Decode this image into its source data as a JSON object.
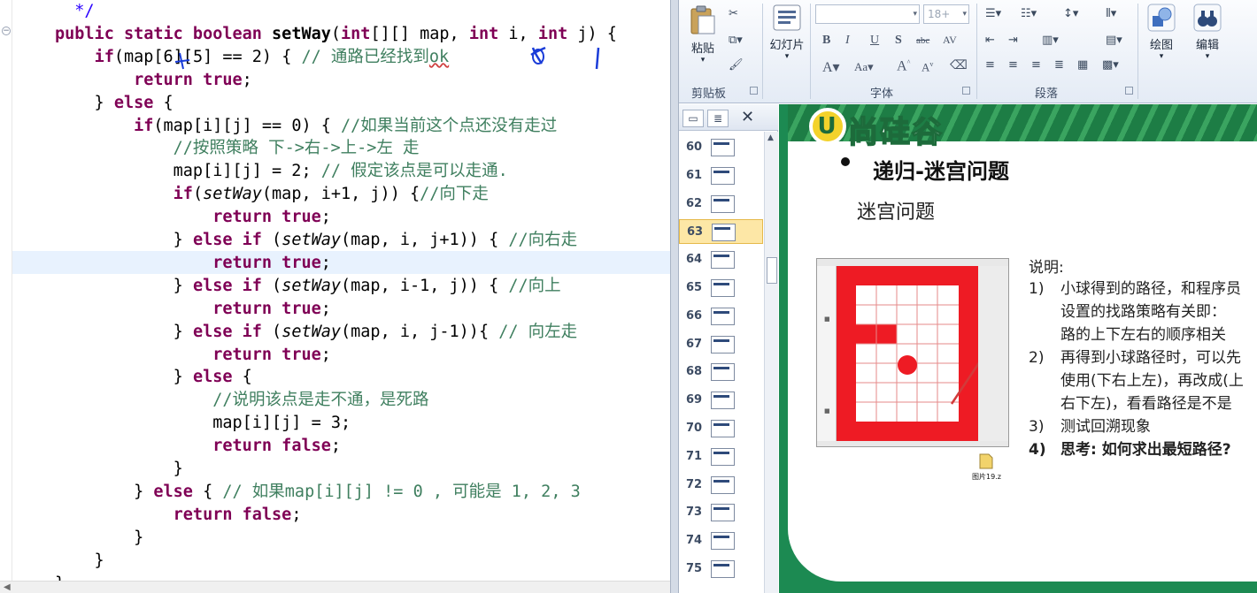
{
  "editor": {
    "lines": [
      [
        {
          "t": "  */",
          "c": "bl"
        }
      ],
      [
        {
          "t": "public static boolean ",
          "c": "kw"
        },
        {
          "t": "setWay",
          "c": "bd"
        },
        {
          "t": "("
        },
        {
          "t": "int",
          "c": "kw"
        },
        {
          "t": "[][] map, "
        },
        {
          "t": "int",
          "c": "kw"
        },
        {
          "t": " i, "
        },
        {
          "t": "int",
          "c": "kw"
        },
        {
          "t": " j) {"
        }
      ],
      [
        {
          "t": "    "
        },
        {
          "t": "if",
          "c": "kw"
        },
        {
          "t": "(map[6][5] == 2) { "
        },
        {
          "t": "// 通路已经找到",
          "c": "cm"
        },
        {
          "t": "ok",
          "c": "cm sq"
        }
      ],
      [
        {
          "t": "        "
        },
        {
          "t": "return true",
          "c": "kw"
        },
        {
          "t": ";"
        }
      ],
      [
        {
          "t": "    } "
        },
        {
          "t": "else",
          "c": "kw"
        },
        {
          "t": " {"
        }
      ],
      [
        {
          "t": "        "
        },
        {
          "t": "if",
          "c": "kw"
        },
        {
          "t": "(map[i][j] == 0) { "
        },
        {
          "t": "//如果当前这个点还没有走过",
          "c": "cm"
        }
      ],
      [
        {
          "t": "            "
        },
        {
          "t": "//按照策略 下->右->上->左 走",
          "c": "cm"
        }
      ],
      [
        {
          "t": "            map[i][j] = 2; "
        },
        {
          "t": "// 假定该点是可以走通.",
          "c": "cm"
        }
      ],
      [
        {
          "t": "            "
        },
        {
          "t": "if",
          "c": "kw"
        },
        {
          "t": "("
        },
        {
          "t": "setWay",
          "c": "it"
        },
        {
          "t": "(map, i+1, j)) {"
        },
        {
          "t": "//向下走",
          "c": "cm"
        }
      ],
      [
        {
          "t": "                "
        },
        {
          "t": "return true",
          "c": "kw"
        },
        {
          "t": ";"
        }
      ],
      [
        {
          "t": "            } "
        },
        {
          "t": "else if",
          "c": "kw"
        },
        {
          "t": " ("
        },
        {
          "t": "setWay",
          "c": "it"
        },
        {
          "t": "(map, i, j+1)) { "
        },
        {
          "t": "//向右走",
          "c": "cm"
        }
      ],
      [
        {
          "t": "                "
        },
        {
          "t": "return true",
          "c": "kw"
        },
        {
          "t": ";"
        }
      ],
      [
        {
          "t": "            } "
        },
        {
          "t": "else if",
          "c": "kw"
        },
        {
          "t": " ("
        },
        {
          "t": "setWay",
          "c": "it"
        },
        {
          "t": "(map, i-1, j)) { "
        },
        {
          "t": "//向上",
          "c": "cm"
        }
      ],
      [
        {
          "t": "                "
        },
        {
          "t": "return true",
          "c": "kw"
        },
        {
          "t": ";"
        }
      ],
      [
        {
          "t": "            } "
        },
        {
          "t": "else if",
          "c": "kw"
        },
        {
          "t": " ("
        },
        {
          "t": "setWay",
          "c": "it"
        },
        {
          "t": "(map, i, j-1)){ "
        },
        {
          "t": "// 向左走",
          "c": "cm"
        }
      ],
      [
        {
          "t": "                "
        },
        {
          "t": "return true",
          "c": "kw"
        },
        {
          "t": ";"
        }
      ],
      [
        {
          "t": "            } "
        },
        {
          "t": "else",
          "c": "kw"
        },
        {
          "t": " {"
        }
      ],
      [
        {
          "t": "                "
        },
        {
          "t": "//说明该点是走不通，是死路",
          "c": "cm"
        }
      ],
      [
        {
          "t": "                map[i][j] = 3;"
        }
      ],
      [
        {
          "t": "                "
        },
        {
          "t": "return false",
          "c": "kw"
        },
        {
          "t": ";"
        }
      ],
      [
        {
          "t": "            }"
        }
      ],
      [
        {
          "t": "        } "
        },
        {
          "t": "else",
          "c": "kw"
        },
        {
          "t": " { "
        },
        {
          "t": "// 如果map[i][j] != 0 , 可能是 1, 2, 3",
          "c": "cm"
        }
      ],
      [
        {
          "t": "            "
        },
        {
          "t": "return false",
          "c": "kw"
        },
        {
          "t": ";"
        }
      ],
      [
        {
          "t": "        }"
        }
      ],
      [
        {
          "t": "    }"
        }
      ],
      [
        {
          "t": "}"
        }
      ]
    ]
  },
  "ribbon": {
    "paste_label": "粘贴",
    "new_slide_label": "幻灯片",
    "font_size_value": "18+",
    "drawing_label": "绘图",
    "editing_label": "编辑",
    "groups": {
      "clipboard": "剪贴板",
      "font": "字体",
      "paragraph": "段落"
    },
    "format_buttons": [
      "B",
      "I",
      "U",
      "S",
      "abc",
      "AV"
    ]
  },
  "thumbs": {
    "slides": [
      "60",
      "61",
      "62",
      "63",
      "64",
      "65",
      "66",
      "67",
      "68",
      "69",
      "70",
      "71",
      "72",
      "73",
      "74",
      "75"
    ],
    "selected": "63",
    "tab_slides_icon": "slides-tab-icon",
    "tab_outline_icon": "outline-tab-icon",
    "close_icon": "close-icon"
  },
  "slide": {
    "logo_text": "尚硅谷",
    "logo_badge": "U",
    "title": "递归-迷宫问题",
    "subtitle": "迷宫问题",
    "notes_heading": "说明:",
    "notes": [
      {
        "num": "1)",
        "lines": [
          "小球得到的路径，和程序员",
          "设置的找路策略有关即：",
          "路的上下左右的顺序相关"
        ]
      },
      {
        "num": "2)",
        "lines": [
          "再得到小球路径时，可以先",
          "使用(下右上左)，再改成(上",
          "右下左)，看看路径是不是"
        ]
      },
      {
        "num": "3)",
        "lines": [
          "测试回溯现象"
        ]
      },
      {
        "num": "4)",
        "lines": [
          "思考: 如何求出最短路径?"
        ]
      }
    ],
    "file_name": "图片19.z",
    "accent_red": "#e60012",
    "accent_green": "#1c8a52"
  }
}
